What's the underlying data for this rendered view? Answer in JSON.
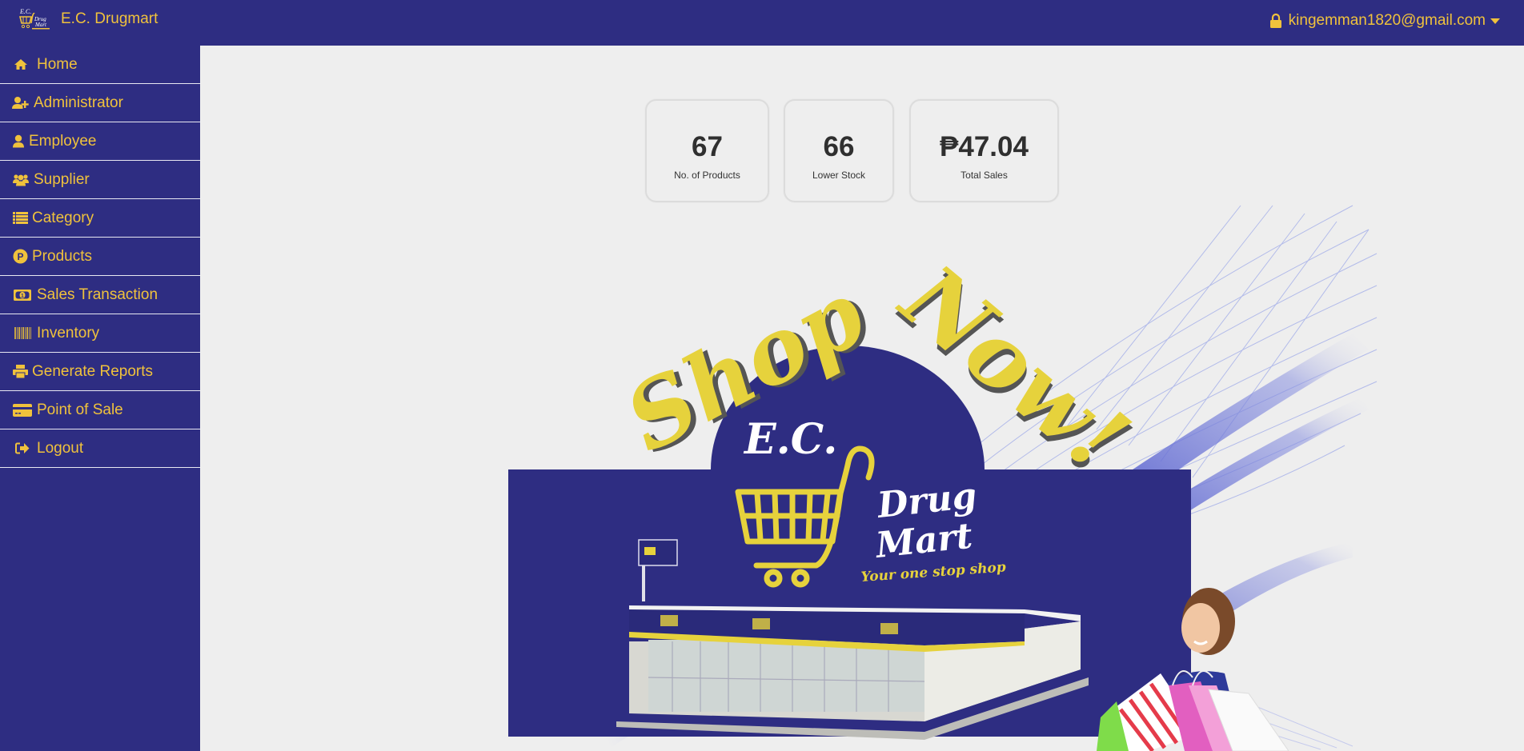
{
  "app": {
    "brand_name": "E.C. Drugmart",
    "user_email": "kingemman1820@gmail.com"
  },
  "colors": {
    "primary": "#2e2d82",
    "accent": "#f0c23c",
    "background": "#eeeeee"
  },
  "sidebar": {
    "items": [
      {
        "label": "Home",
        "icon": "home-icon"
      },
      {
        "label": "Administrator",
        "icon": "user-plus-icon"
      },
      {
        "label": "Employee",
        "icon": "user-icon"
      },
      {
        "label": "Supplier",
        "icon": "users-icon"
      },
      {
        "label": "Category",
        "icon": "list-icon"
      },
      {
        "label": "Products",
        "icon": "peso-circle-icon"
      },
      {
        "label": "Sales Transaction",
        "icon": "money-bill-icon"
      },
      {
        "label": "Inventory",
        "icon": "barcode-icon"
      },
      {
        "label": "Generate Reports",
        "icon": "print-icon"
      },
      {
        "label": "Point of Sale",
        "icon": "credit-card-icon"
      },
      {
        "label": "Logout",
        "icon": "logout-icon"
      }
    ]
  },
  "stats": [
    {
      "value": "67",
      "label": "No. of Products"
    },
    {
      "value": "66",
      "label": "Lower Stock"
    },
    {
      "value": "₱47.04",
      "label": "Total Sales"
    }
  ],
  "banner": {
    "headline": "Shop Now!",
    "logo_top": "E.C.",
    "logo_line1": "Drug",
    "logo_line2": "Mart",
    "tagline": "Your one stop shop"
  }
}
